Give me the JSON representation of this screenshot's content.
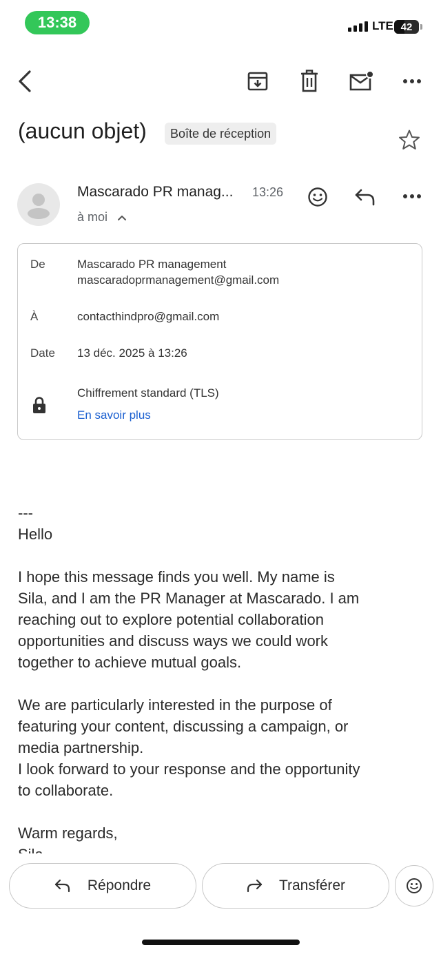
{
  "status_bar": {
    "time": "13:38",
    "network": "LTE",
    "battery_level": "42",
    "battery_fraction": 0.42
  },
  "toolbar": {
    "icons": [
      "back-arrow-icon",
      "archive-icon",
      "trash-icon",
      "mark-unread-icon",
      "more-vert-icon"
    ]
  },
  "email": {
    "subject": "(aucun objet)",
    "label": "Boîte de réception",
    "sender_short": "Mascarado PR manag...",
    "time": "13:26",
    "recipient_summary": "à moi"
  },
  "details": {
    "from_label": "De",
    "from_name": "Mascarado PR management",
    "from_email": "mascaradoprmanagement@gmail.com",
    "to_label": "À",
    "to_email": "contacthindpro@gmail.com",
    "date_label": "Date",
    "date_value": "13 déc. 2025 à 13:26",
    "encryption": "Chiffrement standard (TLS)",
    "learn_more": "En savoir plus"
  },
  "body": {
    "text": "---\nHello\n\nI hope this message finds you well. My name is\nSila, and I am the PR Manager at Mascarado. I am\nreaching out to explore potential collaboration\nopportunities and discuss ways we could work\ntogether to achieve mutual goals.\n\nWe are particularly interested in the purpose of\nfeaturing your content, discussing a campaign, or\nmedia partnership.\nI look forward to your response and the opportunity\nto collaborate.\n\nWarm regards,\nSila"
  },
  "actions": {
    "reply": "Répondre",
    "forward": "Transférer"
  }
}
